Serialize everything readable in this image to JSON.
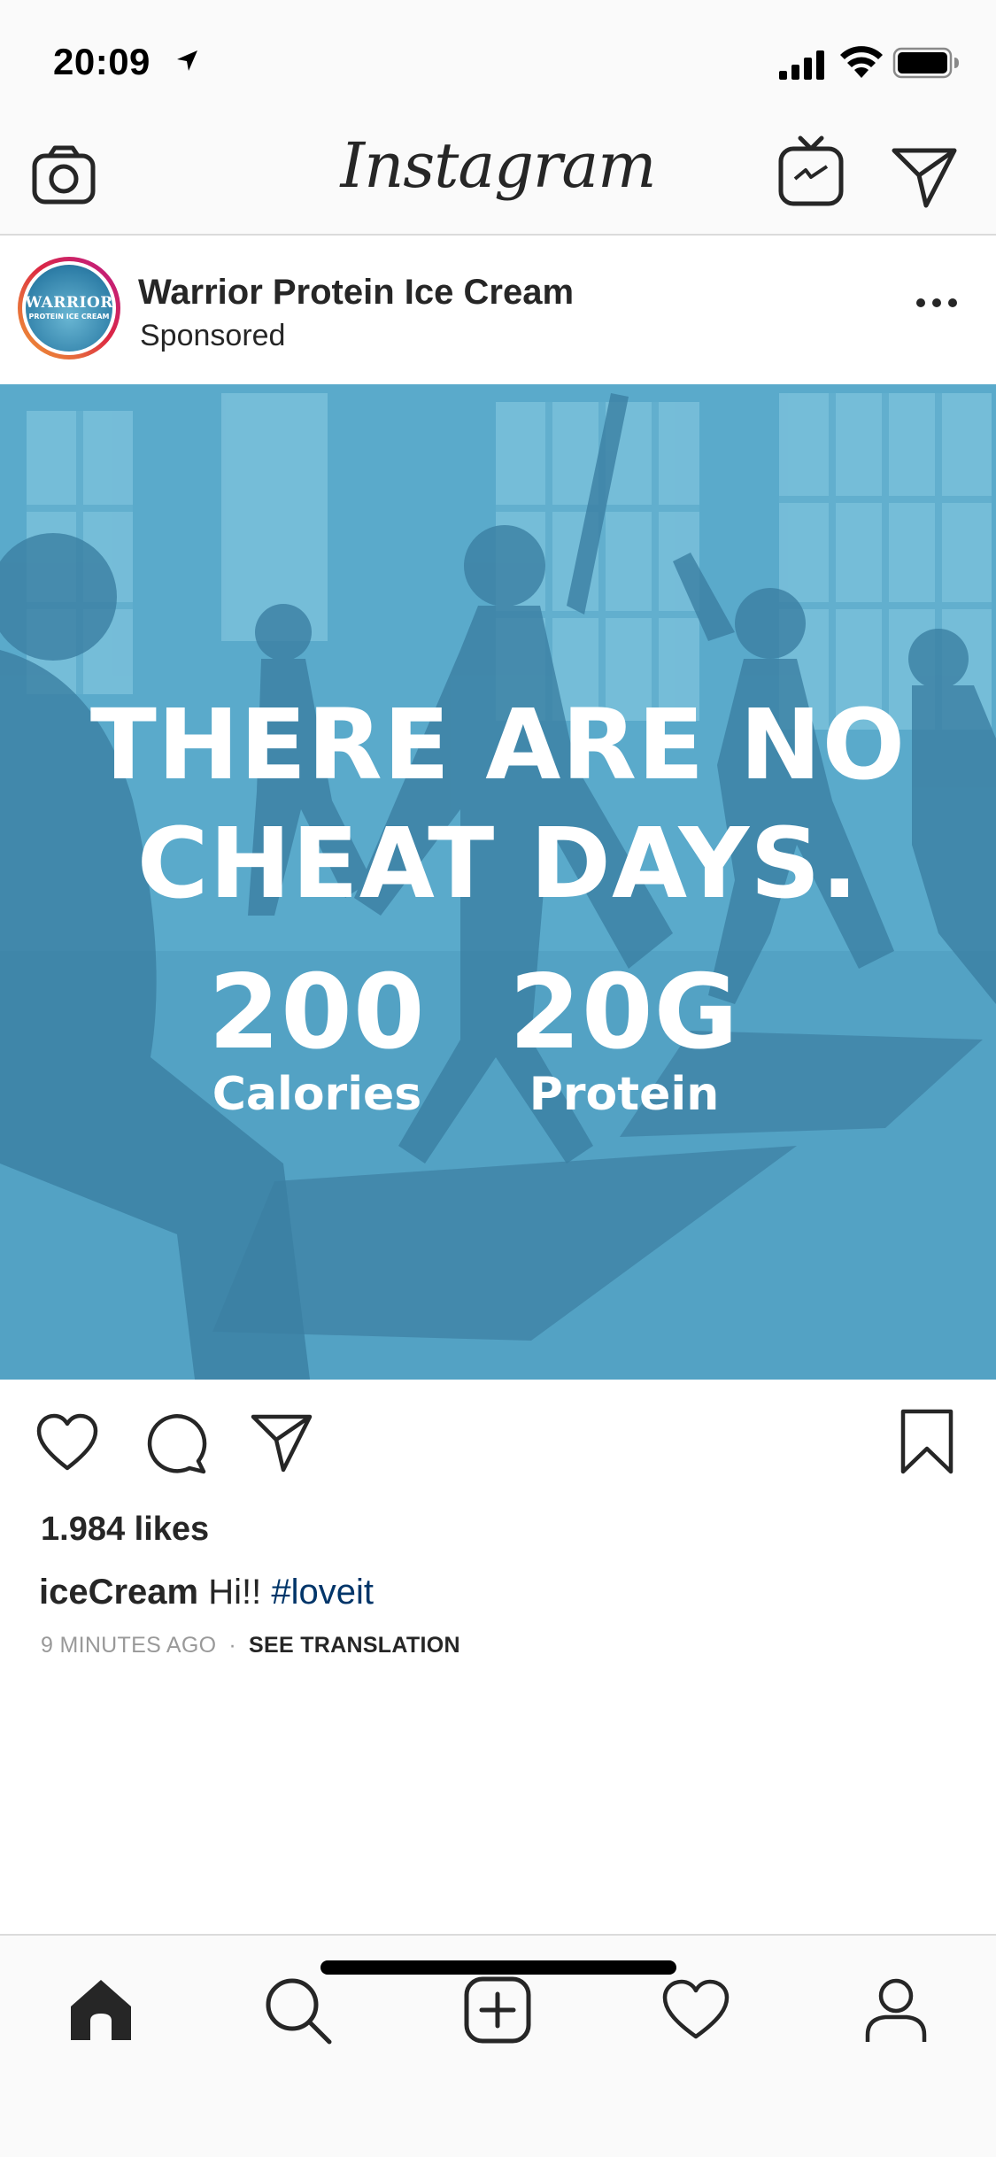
{
  "status_bar": {
    "time": "20:09"
  },
  "nav": {
    "brand": "Instagram"
  },
  "post": {
    "account_name": "Warrior Protein Ice Cream",
    "subtitle": "Sponsored",
    "avatar_text_top": "WARRIOR",
    "avatar_text_bottom": "PROTEIN ICE CREAM",
    "image": {
      "headline_line1": "THERE ARE NO",
      "headline_line2": "CHEAT DAYS.",
      "stat1_value": "200",
      "stat1_label": "Calories",
      "stat2_value": "20G",
      "stat2_label": "Protein",
      "tint_color": "#5aaacb"
    },
    "likes": "1.984 likes",
    "caption_user": "iceCream",
    "caption_text": "Hi!!",
    "caption_hashtag": "#loveit",
    "time_ago": "9 MINUTES AGO",
    "see_translation": "SEE TRANSLATION"
  },
  "colors": {
    "text": "#262626",
    "hashtag": "#003569",
    "muted": "#999999",
    "bar_bg": "#fafafa"
  }
}
